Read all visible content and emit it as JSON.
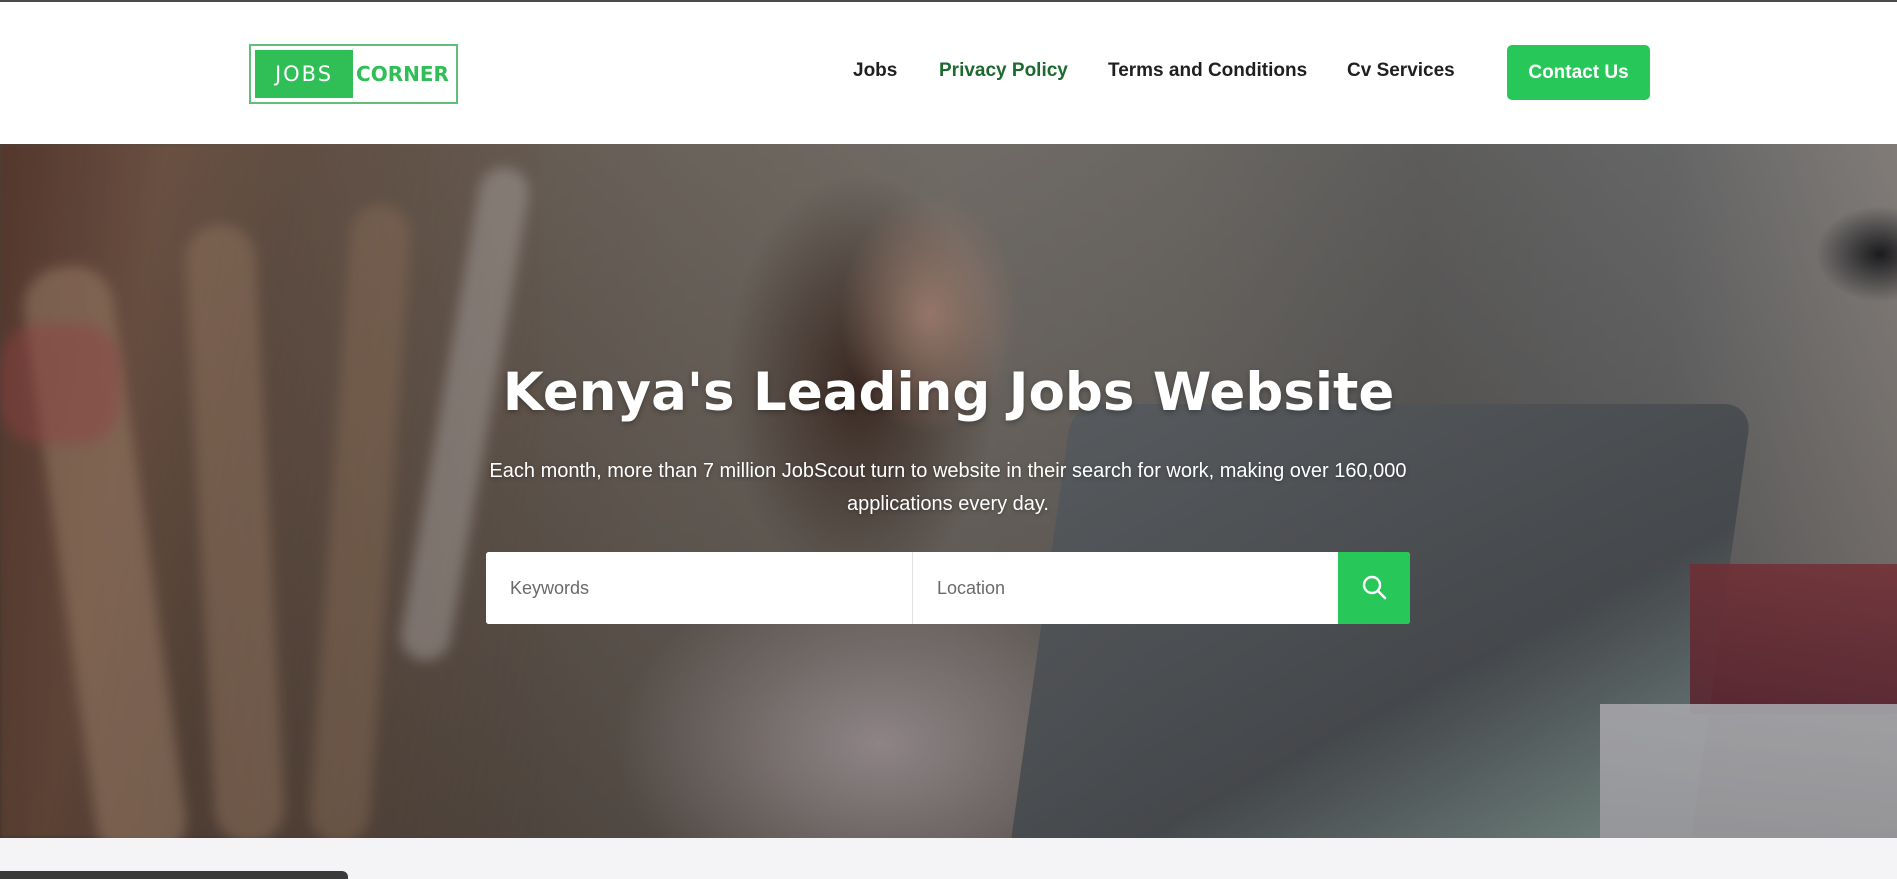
{
  "header": {
    "logo": {
      "left_text": "JOBS",
      "right_text": "CORNER"
    },
    "nav": [
      {
        "label": "Jobs",
        "active": false
      },
      {
        "label": "Privacy Policy",
        "active": true
      },
      {
        "label": "Terms and Conditions",
        "active": false
      },
      {
        "label": "Cv Services",
        "active": false
      }
    ],
    "contact_button": "Contact Us"
  },
  "hero": {
    "title": "Kenya's Leading Jobs Website",
    "subtitle": "Each month, more than 7 million JobScout turn to website in their search for work, making over 160,000 applications every day.",
    "search": {
      "keywords_placeholder": "Keywords",
      "location_placeholder": "Location",
      "button_icon": "search-icon"
    }
  },
  "colors": {
    "accent": "#28c75a",
    "active_nav": "#1e6a2e",
    "text_dark": "#1f1f1f",
    "page_bg": "#f4f4f6"
  }
}
